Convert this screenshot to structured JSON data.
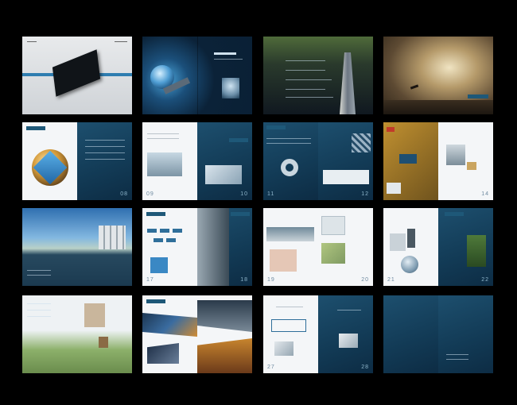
{
  "spreads": [
    {
      "id": "cover",
      "left_logo": "",
      "right_logo": "",
      "left_num": "",
      "right_num": ""
    },
    {
      "id": "satellite",
      "left_logo": "",
      "right_logo": "",
      "left_num": "",
      "right_num": ""
    },
    {
      "id": "skyscraper",
      "left_logo": "",
      "right_logo": "",
      "left_num": "",
      "right_num": ""
    },
    {
      "id": "clouds",
      "left_logo": "",
      "right_logo": "",
      "left_num": "",
      "right_num": ""
    },
    {
      "id": "globe",
      "left_logo": "",
      "right_logo": "",
      "left_num": "",
      "right_num": "08"
    },
    {
      "id": "office",
      "left_logo": "",
      "right_logo": "",
      "left_num": "09",
      "right_num": "10"
    },
    {
      "id": "charts",
      "left_logo": "",
      "right_logo": "",
      "left_num": "11",
      "right_num": "12"
    },
    {
      "id": "circuit",
      "left_logo": "",
      "right_logo": "",
      "left_num": "",
      "right_num": "14"
    },
    {
      "id": "lake",
      "left_logo": "",
      "right_logo": "",
      "left_num": "",
      "right_num": ""
    },
    {
      "id": "diagram",
      "left_logo": "",
      "right_logo": "",
      "left_num": "17",
      "right_num": "18"
    },
    {
      "id": "map",
      "left_logo": "",
      "right_logo": "",
      "left_num": "19",
      "right_num": "20"
    },
    {
      "id": "devices",
      "left_logo": "",
      "right_logo": "",
      "left_num": "21",
      "right_num": "22"
    },
    {
      "id": "aerial",
      "left_logo": "",
      "right_logo": "",
      "left_num": "",
      "right_num": ""
    },
    {
      "id": "control-room",
      "left_logo": "",
      "right_logo": "",
      "left_num": "",
      "right_num": ""
    },
    {
      "id": "people",
      "left_logo": "",
      "right_logo": "",
      "left_num": "27",
      "right_num": "28"
    },
    {
      "id": "back-cover",
      "left_logo": "",
      "right_logo": "",
      "left_num": "",
      "right_num": ""
    }
  ],
  "colors": {
    "background": "#000000",
    "navy": "#123a55",
    "accent": "#2f6f9a",
    "paper": "#f4f6f8"
  }
}
